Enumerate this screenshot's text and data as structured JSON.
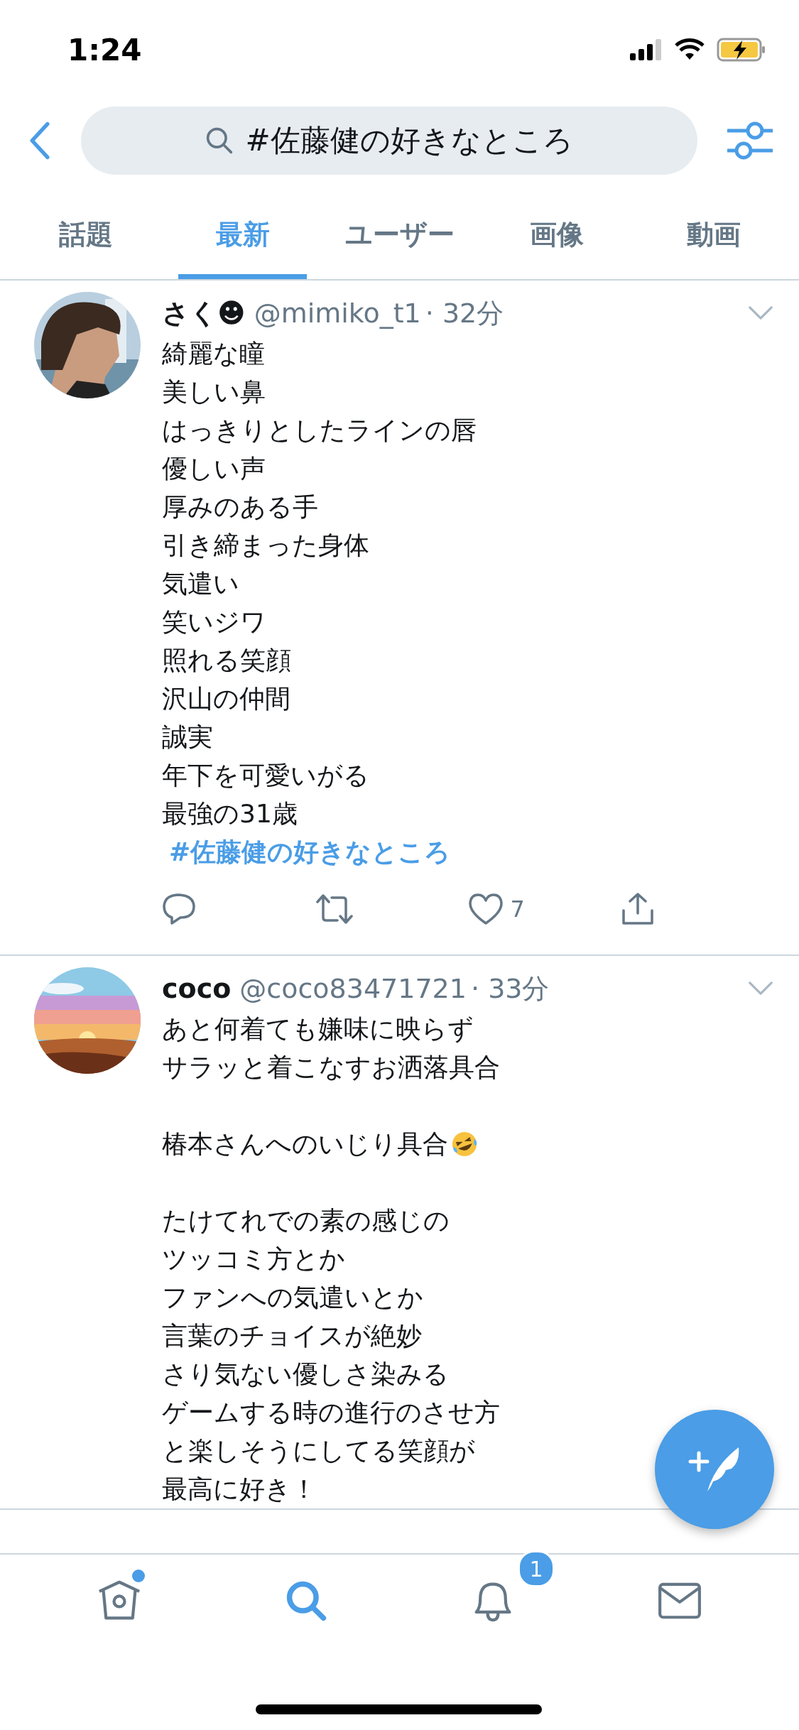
{
  "status_bar": {
    "time": "1:24"
  },
  "search": {
    "query": "#佐藤健の好きなところ"
  },
  "tabs": [
    {
      "label": "話題",
      "selected": false
    },
    {
      "label": "最新",
      "selected": true
    },
    {
      "label": "ユーザー",
      "selected": false
    },
    {
      "label": "画像",
      "selected": false
    },
    {
      "label": "動画",
      "selected": false
    }
  ],
  "tweets": [
    {
      "name": "さく☻",
      "handle": "@mimiko_t1",
      "time": "· 32分",
      "lines": [
        {
          "kind": "text",
          "text": "綺麗な瞳"
        },
        {
          "kind": "text",
          "text": "美しい鼻"
        },
        {
          "kind": "text",
          "text": "はっきりとしたラインの唇"
        },
        {
          "kind": "text",
          "text": "優しい声"
        },
        {
          "kind": "text",
          "text": "厚みのある手"
        },
        {
          "kind": "text",
          "text": "引き締まった身体"
        },
        {
          "kind": "text",
          "text": "気遣い"
        },
        {
          "kind": "text",
          "text": "笑いジワ"
        },
        {
          "kind": "text",
          "text": "照れる笑顔"
        },
        {
          "kind": "text",
          "text": "沢山の仲間"
        },
        {
          "kind": "text",
          "text": "誠実"
        },
        {
          "kind": "text",
          "text": "年下を可愛いがる"
        },
        {
          "kind": "text",
          "text": "最強の31歳"
        },
        {
          "kind": "hashtag",
          "text": "#佐藤健の好きなところ"
        }
      ],
      "likes": "7"
    },
    {
      "name": "coco",
      "handle": "@coco83471721",
      "time": "· 33分",
      "lines": [
        {
          "kind": "text",
          "text": "あと何着ても嫌味に映らず"
        },
        {
          "kind": "text",
          "text": "サラッと着こなすお洒落具合"
        },
        {
          "kind": "blank"
        },
        {
          "kind": "emoji",
          "text": "椿本さんへのいじり具合"
        },
        {
          "kind": "blank"
        },
        {
          "kind": "text",
          "text": "たけてれでの素の感じの"
        },
        {
          "kind": "text",
          "text": "ツッコミ方とか"
        },
        {
          "kind": "text",
          "text": "ファンへの気遣いとか"
        },
        {
          "kind": "text",
          "text": "言葉のチョイスが絶妙"
        },
        {
          "kind": "text",
          "text": "さり気ない優しさ染みる"
        },
        {
          "kind": "text",
          "text": "ゲームする時の進行のさせ方"
        },
        {
          "kind": "text",
          "text": "と楽しそうにしてる笑顔が"
        },
        {
          "kind": "text",
          "text": "最高に好き！"
        }
      ]
    }
  ],
  "nav": [
    {
      "kind": "home",
      "selected": false,
      "dot": true
    },
    {
      "kind": "search",
      "selected": true
    },
    {
      "kind": "bell",
      "selected": false,
      "badge": "1"
    },
    {
      "kind": "mail",
      "selected": false
    }
  ]
}
